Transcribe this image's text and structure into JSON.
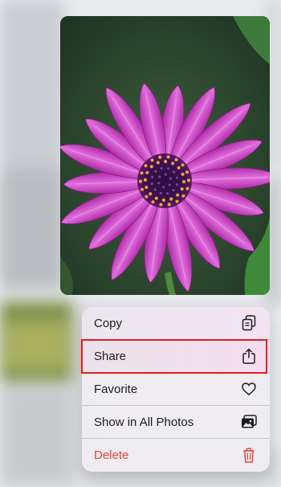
{
  "menu": {
    "items": [
      {
        "label": "Copy",
        "icon": "copy-icon"
      },
      {
        "label": "Share",
        "icon": "share-icon"
      },
      {
        "label": "Favorite",
        "icon": "heart-icon"
      },
      {
        "label": "Show in All Photos",
        "icon": "photo-library-icon"
      },
      {
        "label": "Delete",
        "icon": "trash-icon",
        "color": "#e0453b"
      }
    ]
  },
  "highlight": {
    "target": "Share",
    "color": "#e0201c"
  },
  "preview": {
    "subject": "pink daisy flower",
    "petal_color": "#c93cc4",
    "background_color": "#2e4a34"
  }
}
